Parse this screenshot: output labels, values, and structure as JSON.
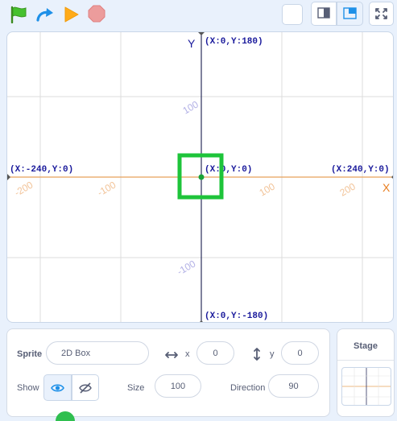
{
  "stage": {
    "axis_y_title": "Y",
    "axis_x_title": "X",
    "coord_top": "(X:0,Y:180)",
    "coord_bottom": "(X:0,Y:-180)",
    "coord_left": "(X:-240,Y:0)",
    "coord_right": "(X:240,Y:0)",
    "coord_center": "(X:0,Y:0)",
    "ticks_x": [
      "-200",
      "-100",
      "100",
      "200"
    ],
    "ticks_y": [
      "100",
      "-100"
    ]
  },
  "sprite_info": {
    "sprite_label": "Sprite",
    "sprite_name": "2D Box",
    "x_label": "x",
    "x_value": "0",
    "y_label": "y",
    "y_value": "0",
    "show_label": "Show",
    "size_label": "Size",
    "size_value": "100",
    "direction_label": "Direction",
    "direction_value": "90"
  },
  "stage_panel": {
    "title": "Stage"
  },
  "colors": {
    "x_axis": "#e8a15a",
    "y_axis": "#2b2f5c",
    "highlight": "#1ec43a",
    "label_blue": "#1a1a9c",
    "label_orange": "#e87d1e"
  }
}
